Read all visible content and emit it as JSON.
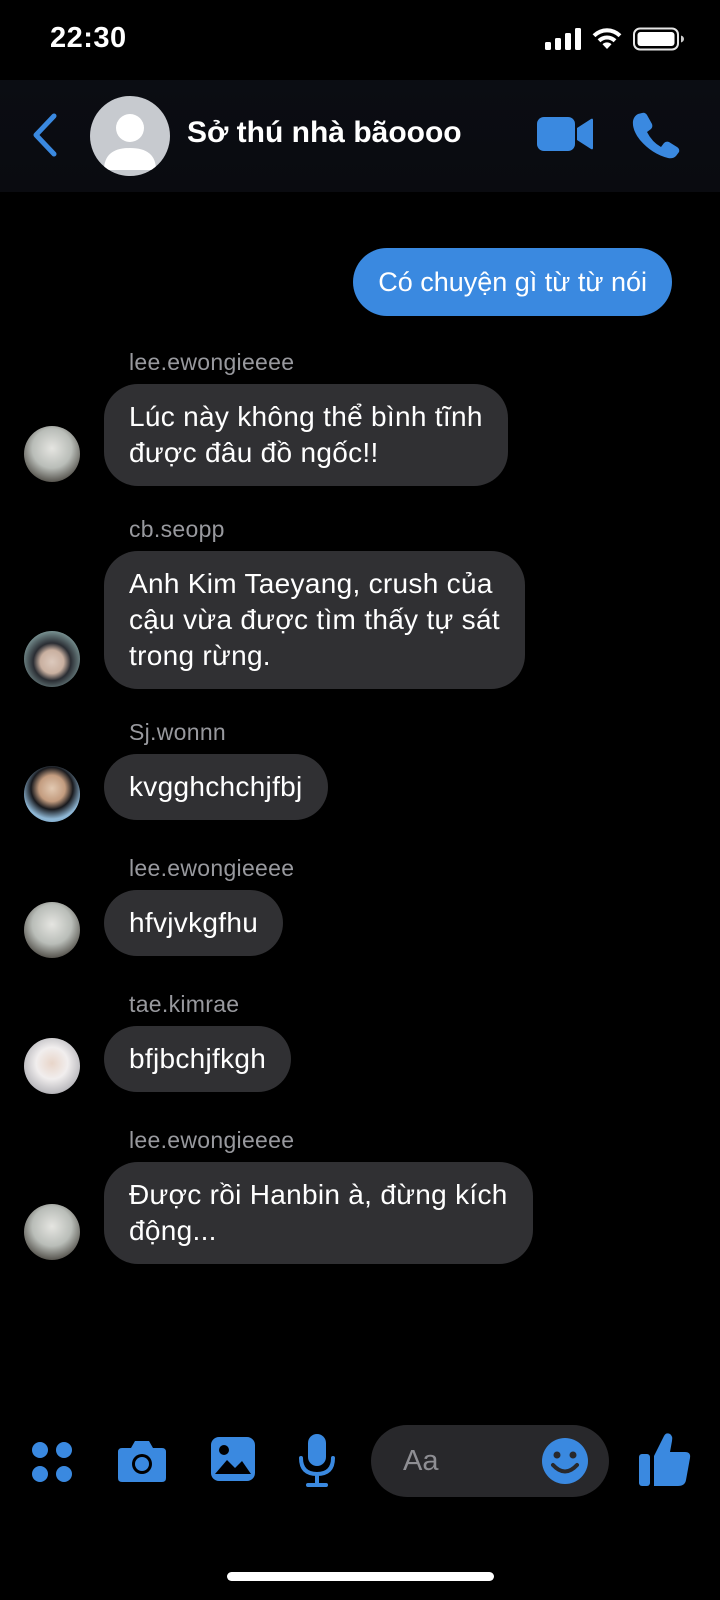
{
  "status_bar": {
    "time": "22:30"
  },
  "header": {
    "title": "Sở thú nhà bãoooo",
    "icons": {
      "back": "chevron-left-icon",
      "video": "video-camera-icon",
      "phone": "phone-icon"
    }
  },
  "messages": [
    {
      "type": "sent",
      "text": "Có chuyện gì từ từ nói"
    },
    {
      "type": "received",
      "sender": "lee.ewongieeee",
      "lines": [
        "Lúc này không thể bình tĩnh",
        "được đâu đồ ngốc!!"
      ]
    },
    {
      "type": "received",
      "sender": "cb.seopp",
      "lines": [
        "Anh Kim Taeyang, crush của",
        "cậu vừa được tìm thấy tự sát",
        "trong rừng."
      ]
    },
    {
      "type": "received",
      "sender": "Sj.wonnn",
      "lines": [
        "kvgghchchjfbj"
      ]
    },
    {
      "type": "received",
      "sender": "lee.ewongieeee",
      "lines": [
        "hfvjvkgfhu"
      ]
    },
    {
      "type": "received",
      "sender": "tae.kimrae",
      "lines": [
        "bfjbchjfkgh"
      ]
    },
    {
      "type": "received",
      "sender": "lee.ewongieeee",
      "lines": [
        "Được rồi Hanbin à, đừng kích",
        "động..."
      ]
    }
  ],
  "composer": {
    "placeholder": "Aa",
    "icons": [
      "apps-icon",
      "camera-icon",
      "gallery-icon",
      "microphone-icon",
      "emoji-icon",
      "thumbs-up-icon"
    ]
  },
  "colors": {
    "accent": "#3a89e0",
    "bubble_received": "#303033",
    "background": "#000000"
  }
}
